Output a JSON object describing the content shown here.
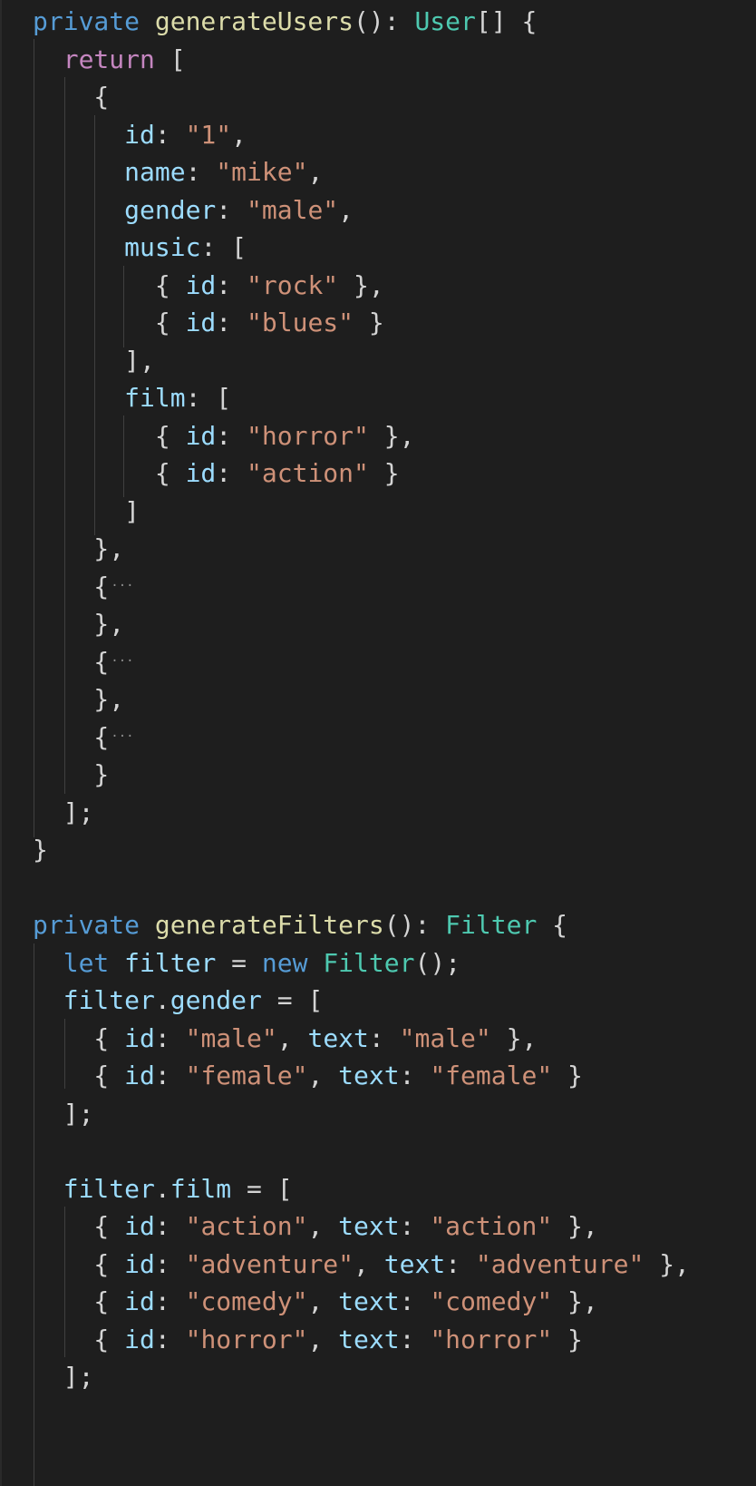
{
  "editor": {
    "code_lines": [
      {
        "tokens": [
          {
            "t": "private ",
            "c": "kw"
          },
          {
            "t": "generateUsers",
            "c": "fn"
          },
          {
            "t": "(): ",
            "c": "punc"
          },
          {
            "t": "User",
            "c": "type"
          },
          {
            "t": "[] {",
            "c": "punc"
          }
        ]
      },
      {
        "tokens": [
          {
            "t": "  return ",
            "c": "kw2"
          },
          {
            "t": "[",
            "c": "punc"
          }
        ]
      },
      {
        "tokens": [
          {
            "t": "    {",
            "c": "punc"
          }
        ]
      },
      {
        "tokens": [
          {
            "t": "      id",
            "c": "prop"
          },
          {
            "t": ": ",
            "c": "punc"
          },
          {
            "t": "\"1\"",
            "c": "str"
          },
          {
            "t": ",",
            "c": "punc"
          }
        ]
      },
      {
        "tokens": [
          {
            "t": "      name",
            "c": "prop"
          },
          {
            "t": ": ",
            "c": "punc"
          },
          {
            "t": "\"mike\"",
            "c": "str"
          },
          {
            "t": ",",
            "c": "punc"
          }
        ]
      },
      {
        "tokens": [
          {
            "t": "      gender",
            "c": "prop"
          },
          {
            "t": ": ",
            "c": "punc"
          },
          {
            "t": "\"male\"",
            "c": "str"
          },
          {
            "t": ",",
            "c": "punc"
          }
        ]
      },
      {
        "tokens": [
          {
            "t": "      music",
            "c": "prop"
          },
          {
            "t": ": [",
            "c": "punc"
          }
        ]
      },
      {
        "tokens": [
          {
            "t": "        { ",
            "c": "punc"
          },
          {
            "t": "id",
            "c": "prop"
          },
          {
            "t": ": ",
            "c": "punc"
          },
          {
            "t": "\"rock\"",
            "c": "str"
          },
          {
            "t": " },",
            "c": "punc"
          }
        ]
      },
      {
        "tokens": [
          {
            "t": "        { ",
            "c": "punc"
          },
          {
            "t": "id",
            "c": "prop"
          },
          {
            "t": ": ",
            "c": "punc"
          },
          {
            "t": "\"blues\"",
            "c": "str"
          },
          {
            "t": " }",
            "c": "punc"
          }
        ]
      },
      {
        "tokens": [
          {
            "t": "      ],",
            "c": "punc"
          }
        ]
      },
      {
        "tokens": [
          {
            "t": "      film",
            "c": "prop"
          },
          {
            "t": ": [",
            "c": "punc"
          }
        ]
      },
      {
        "tokens": [
          {
            "t": "        { ",
            "c": "punc"
          },
          {
            "t": "id",
            "c": "prop"
          },
          {
            "t": ": ",
            "c": "punc"
          },
          {
            "t": "\"horror\"",
            "c": "str"
          },
          {
            "t": " },",
            "c": "punc"
          }
        ]
      },
      {
        "tokens": [
          {
            "t": "        { ",
            "c": "punc"
          },
          {
            "t": "id",
            "c": "prop"
          },
          {
            "t": ": ",
            "c": "punc"
          },
          {
            "t": "\"action\"",
            "c": "str"
          },
          {
            "t": " }",
            "c": "punc"
          }
        ]
      },
      {
        "tokens": [
          {
            "t": "      ]",
            "c": "punc"
          }
        ]
      },
      {
        "tokens": [
          {
            "t": "    },",
            "c": "punc"
          }
        ]
      },
      {
        "tokens": [
          {
            "t": "    {",
            "c": "punc"
          }
        ],
        "folded": true,
        "fold_text": "···"
      },
      {
        "tokens": [
          {
            "t": "    },",
            "c": "punc"
          }
        ]
      },
      {
        "tokens": [
          {
            "t": "    {",
            "c": "punc"
          }
        ],
        "folded": true,
        "fold_text": "···"
      },
      {
        "tokens": [
          {
            "t": "    },",
            "c": "punc"
          }
        ]
      },
      {
        "tokens": [
          {
            "t": "    {",
            "c": "punc"
          }
        ],
        "folded": true,
        "fold_text": "···"
      },
      {
        "tokens": [
          {
            "t": "    }",
            "c": "punc"
          }
        ]
      },
      {
        "tokens": [
          {
            "t": "  ];",
            "c": "punc"
          }
        ]
      },
      {
        "tokens": [
          {
            "t": "}",
            "c": "punc"
          }
        ]
      },
      {
        "tokens": []
      },
      {
        "tokens": [
          {
            "t": "private ",
            "c": "kw"
          },
          {
            "t": "generateFilters",
            "c": "fn"
          },
          {
            "t": "(): ",
            "c": "punc"
          },
          {
            "t": "Filter",
            "c": "type"
          },
          {
            "t": " {",
            "c": "punc"
          }
        ]
      },
      {
        "tokens": [
          {
            "t": "  let ",
            "c": "kw"
          },
          {
            "t": "filter",
            "c": "prop"
          },
          {
            "t": " = ",
            "c": "punc"
          },
          {
            "t": "new ",
            "c": "kw"
          },
          {
            "t": "Filter",
            "c": "type"
          },
          {
            "t": "();",
            "c": "punc"
          }
        ]
      },
      {
        "tokens": [
          {
            "t": "  filter",
            "c": "prop"
          },
          {
            "t": ".",
            "c": "punc"
          },
          {
            "t": "gender",
            "c": "prop"
          },
          {
            "t": " = [",
            "c": "punc"
          }
        ]
      },
      {
        "tokens": [
          {
            "t": "    { ",
            "c": "punc"
          },
          {
            "t": "id",
            "c": "prop"
          },
          {
            "t": ": ",
            "c": "punc"
          },
          {
            "t": "\"male\"",
            "c": "str"
          },
          {
            "t": ", ",
            "c": "punc"
          },
          {
            "t": "text",
            "c": "prop"
          },
          {
            "t": ": ",
            "c": "punc"
          },
          {
            "t": "\"male\"",
            "c": "str"
          },
          {
            "t": " },",
            "c": "punc"
          }
        ]
      },
      {
        "tokens": [
          {
            "t": "    { ",
            "c": "punc"
          },
          {
            "t": "id",
            "c": "prop"
          },
          {
            "t": ": ",
            "c": "punc"
          },
          {
            "t": "\"female\"",
            "c": "str"
          },
          {
            "t": ", ",
            "c": "punc"
          },
          {
            "t": "text",
            "c": "prop"
          },
          {
            "t": ": ",
            "c": "punc"
          },
          {
            "t": "\"female\"",
            "c": "str"
          },
          {
            "t": " }",
            "c": "punc"
          }
        ]
      },
      {
        "tokens": [
          {
            "t": "  ];",
            "c": "punc"
          }
        ]
      },
      {
        "tokens": []
      },
      {
        "tokens": [
          {
            "t": "  filter",
            "c": "prop"
          },
          {
            "t": ".",
            "c": "punc"
          },
          {
            "t": "film",
            "c": "prop"
          },
          {
            "t": " = [",
            "c": "punc"
          }
        ]
      },
      {
        "tokens": [
          {
            "t": "    { ",
            "c": "punc"
          },
          {
            "t": "id",
            "c": "prop"
          },
          {
            "t": ": ",
            "c": "punc"
          },
          {
            "t": "\"action\"",
            "c": "str"
          },
          {
            "t": ", ",
            "c": "punc"
          },
          {
            "t": "text",
            "c": "prop"
          },
          {
            "t": ": ",
            "c": "punc"
          },
          {
            "t": "\"action\"",
            "c": "str"
          },
          {
            "t": " },",
            "c": "punc"
          }
        ]
      },
      {
        "tokens": [
          {
            "t": "    { ",
            "c": "punc"
          },
          {
            "t": "id",
            "c": "prop"
          },
          {
            "t": ": ",
            "c": "punc"
          },
          {
            "t": "\"adventure\"",
            "c": "str"
          },
          {
            "t": ", ",
            "c": "punc"
          },
          {
            "t": "text",
            "c": "prop"
          },
          {
            "t": ": ",
            "c": "punc"
          },
          {
            "t": "\"adventure\"",
            "c": "str"
          },
          {
            "t": " },",
            "c": "punc"
          }
        ]
      },
      {
        "tokens": [
          {
            "t": "    { ",
            "c": "punc"
          },
          {
            "t": "id",
            "c": "prop"
          },
          {
            "t": ": ",
            "c": "punc"
          },
          {
            "t": "\"comedy\"",
            "c": "str"
          },
          {
            "t": ", ",
            "c": "punc"
          },
          {
            "t": "text",
            "c": "prop"
          },
          {
            "t": ": ",
            "c": "punc"
          },
          {
            "t": "\"comedy\"",
            "c": "str"
          },
          {
            "t": " },",
            "c": "punc"
          }
        ]
      },
      {
        "tokens": [
          {
            "t": "    { ",
            "c": "punc"
          },
          {
            "t": "id",
            "c": "prop"
          },
          {
            "t": ": ",
            "c": "punc"
          },
          {
            "t": "\"horror\"",
            "c": "str"
          },
          {
            "t": ", ",
            "c": "punc"
          },
          {
            "t": "text",
            "c": "prop"
          },
          {
            "t": ": ",
            "c": "punc"
          },
          {
            "t": "\"horror\"",
            "c": "str"
          },
          {
            "t": " }",
            "c": "punc"
          }
        ]
      },
      {
        "tokens": [
          {
            "t": "  ];",
            "c": "punc"
          }
        ]
      }
    ],
    "token_colors": {
      "kw": "#569cd6",
      "fn": "#dcdcaa",
      "type": "#4ec9b0",
      "prop": "#9cdcfe",
      "str": "#ce9178",
      "kw2": "#c586c0",
      "punc": "#d4d4d4"
    }
  }
}
